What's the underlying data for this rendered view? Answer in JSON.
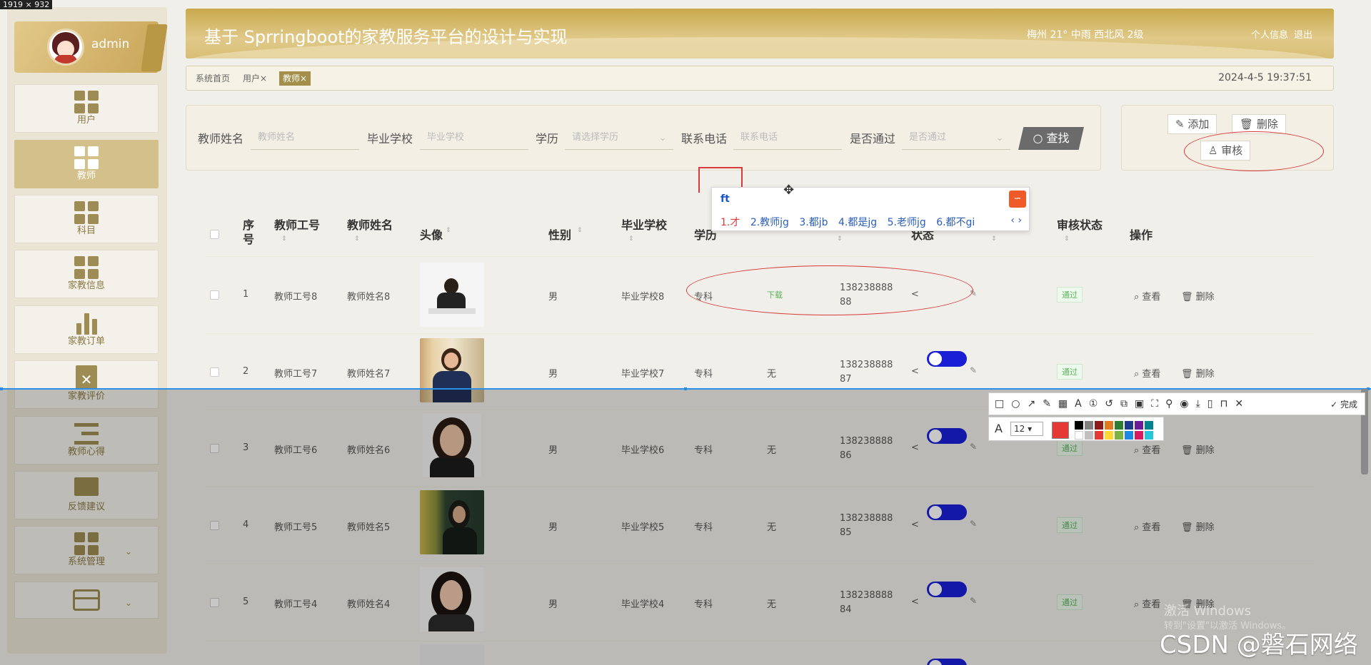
{
  "screen_size_label": "1919 × 932",
  "app": {
    "user": "admin",
    "title": "基于 Sprringboot的家教服务平台的设计与实现",
    "weather": "梅州  21°  中雨  西北风  2级",
    "header_links": [
      "个人信息",
      "退出"
    ],
    "datetime": "2024-4-5 19:37:51"
  },
  "sidebar": [
    {
      "label": "用户",
      "icon": "grid-icon"
    },
    {
      "label": "教师",
      "icon": "grid-icon",
      "active": true
    },
    {
      "label": "科目",
      "icon": "grid-icon"
    },
    {
      "label": "家教信息",
      "icon": "grid-icon"
    },
    {
      "label": "家教订单",
      "icon": "bar-chart-icon"
    },
    {
      "label": "家教评价",
      "icon": "clipboard-x-icon"
    },
    {
      "label": "教师心得",
      "icon": "indent-list-icon"
    },
    {
      "label": "反馈建议",
      "icon": "monitor-icon"
    },
    {
      "label": "系统管理",
      "icon": "grid-icon"
    },
    {
      "label": "",
      "icon": "card-icon"
    }
  ],
  "tabs": [
    "系统首页",
    "用户×",
    "教师×"
  ],
  "search": {
    "fields": [
      {
        "label": "教师姓名",
        "placeholder": "教师姓名"
      },
      {
        "label": "毕业学校",
        "placeholder": "毕业学校"
      },
      {
        "label": "学历",
        "placeholder": "请选择学历"
      },
      {
        "label": "联系电话",
        "placeholder": "联系电话"
      },
      {
        "label": "是否通过",
        "placeholder": "是否通过"
      }
    ],
    "button": "查找"
  },
  "actions": {
    "add": "添加",
    "delete": "删除",
    "audit": "审核"
  },
  "table": {
    "headers": {
      "index": "序号",
      "teacher_no": "教师工号",
      "teacher_name": "教师姓名",
      "avatar": "头像",
      "gender": "性别",
      "school": "毕业学校",
      "education": "学历",
      "status": "状态",
      "audit_status": "审核状态",
      "ops": "操作"
    },
    "rows": [
      {
        "index": "1",
        "no": "教师工号8",
        "name": "教师姓名8",
        "gender": "男",
        "school": "毕业学校8",
        "edu": "专科",
        "file": "下载",
        "phone": "138238888 88",
        "audit": "通过"
      },
      {
        "index": "2",
        "no": "教师工号7",
        "name": "教师姓名7",
        "gender": "男",
        "school": "毕业学校7",
        "edu": "专科",
        "file": "无",
        "phone": "138238888 87",
        "audit": "通过"
      },
      {
        "index": "3",
        "no": "教师工号6",
        "name": "教师姓名6",
        "gender": "男",
        "school": "毕业学校6",
        "edu": "专科",
        "file": "无",
        "phone": "138238888 86",
        "audit": "通过"
      },
      {
        "index": "4",
        "no": "教师工号5",
        "name": "教师姓名5",
        "gender": "男",
        "school": "毕业学校5",
        "edu": "专科",
        "file": "无",
        "phone": "138238888 85",
        "audit": "通过"
      },
      {
        "index": "5",
        "no": "教师工号4",
        "name": "教师姓名4",
        "gender": "男",
        "school": "毕业学校4",
        "edu": "专科",
        "file": "无",
        "phone": "138238888 84",
        "audit": "通过"
      }
    ],
    "row_ops": {
      "view": "查看",
      "delete": "删除"
    }
  },
  "ime": {
    "input": "ft",
    "candidates": [
      "1.才",
      "2.教师jg",
      "3.都jb",
      "4.都是jg",
      "5.老师jg",
      "6.都不gi"
    ],
    "nav": "‹ ›"
  },
  "snip_toolbar": {
    "done": "完成",
    "font_size": "12"
  },
  "watermark": {
    "line1": "激活 Windows",
    "line2": "转到\"设置\"以激活 Windows。"
  },
  "brand": "CSDN @磐石网络"
}
